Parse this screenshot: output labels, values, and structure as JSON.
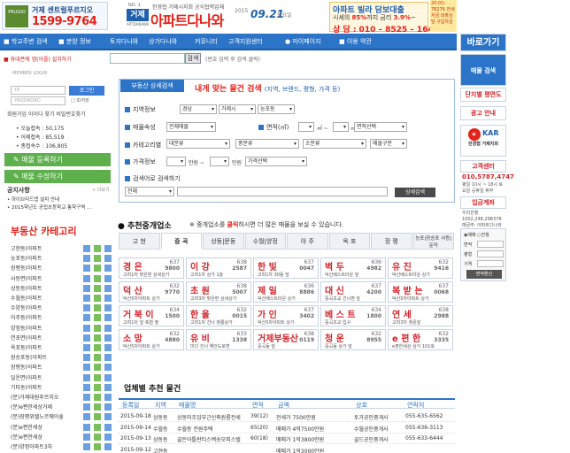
{
  "header": {
    "ad_left_logo": "PRUGIO",
    "ad_left_line1": "거제 센트럴푸르지오",
    "ad_left_phone": "1599-9764",
    "logo_no": "NO. 1",
    "logo_box": "거제",
    "logo_sub": "APTDANAWA",
    "logo_caption": "한경협 거제시지회 공식협력업체",
    "logo_main": "아파트다나와",
    "year": "2015",
    "date": "09.21",
    "weekday": "월요일",
    "ad_mid_line1": "아파트 빌라 담보대출",
    "ad_mid_line2_prefix": "시세의 ",
    "ad_mid_rate1": "85%",
    "ad_mid_line2_mid": "까지 금리 ",
    "ad_mid_rate2": "3.9%",
    "ad_mid_line2_suffix": "~",
    "ad_mid_line3": "상 담 : 010 – 8525 – 1644",
    "ad_right": "20-01-78276 전세자금 대출상담 구입자금"
  },
  "nav": {
    "items": [
      "학교주변 검색",
      "분양 정보",
      "토지다나와",
      "상가다나와",
      "커뮤니티",
      "고객지원센터",
      "마이페이지",
      "이용 약관"
    ]
  },
  "search_bar": {
    "notice": "휴대폰에 앱(어플) 설치하기",
    "button": "검색",
    "hint": "(번호 입력 후 검색 클릭)"
  },
  "login": {
    "label": "MEMBER LOGIN",
    "id_placeholder": "ID",
    "pw_placeholder": "PASSWORD",
    "login_button": "로그인",
    "save_id": "ID저장",
    "links": "회원가입 아이디 찾기 비밀번호찾기",
    "stats": [
      {
        "label": "오늘접속",
        "value": "50,175"
      },
      {
        "label": "어제접속",
        "value": "85,519"
      },
      {
        "label": "총접속수",
        "value": "106,805"
      }
    ]
  },
  "left_buttons": {
    "register": "매물 등록하기",
    "modify": "매물 수정하기"
  },
  "notice_board": {
    "title": "공지사항",
    "more": "+ 더보기",
    "items": [
      "• 하이브리드앱 설치 안내",
      "• 2015학년도 공립초등학교 통학구역 …"
    ]
  },
  "categories": {
    "title": "부동산 카테고리",
    "items": [
      "고현동(아파트",
      "능포동(아파트",
      "장평동(아파트",
      "사등면(아파트",
      "상동동(아파트",
      "수월동(아파트",
      "수양동(아파트",
      "아주동(아파트",
      "양정동(아파트",
      "연초면(아파트",
      "옥포동(아파트",
      "장승포동(아파트",
      "장평동(아파트",
      "일운면(아파트",
      "기타동(아파트",
      "(분)거제대원푸르지오",
      "(분)e편한세상거제",
      "(분)장평위렐노르웨이숲",
      "(분)e편한세상",
      "(분)e편한세상",
      "(분)양정아파트3차",
      "(분)거제KCC스위첸"
    ]
  },
  "panel": {
    "tab": "부동산 상세검색",
    "title": "내게 맞는 물건 검색",
    "title_sub": "(지역, 브랜드, 평형, 가격 등)",
    "rows": {
      "region": "지역정보",
      "type": "매물속성",
      "category": "카테고리별",
      "price": "가격정보",
      "keyword": "검색어로 검색하기"
    },
    "region_sel": [
      "경남",
      "거제시",
      "능포동"
    ],
    "type_sel": "전체매물",
    "area_label": "면적(㎡)",
    "area_unit1": "㎡ ~",
    "area_unit2": "㎡",
    "area_sel": "면적선택",
    "cat_sel": [
      "대분류",
      "중분류",
      "소분류",
      "매물구분"
    ],
    "price_unit1": "만원 ~",
    "price_unit2": "만원",
    "price_sel": "가격선택",
    "keyword_sel": "전체",
    "search_button": "상세검색"
  },
  "recommend": {
    "title": "추천중개업소",
    "note_prefix": "※ 중개업소를 ",
    "note_click": "클릭",
    "note_suffix": "하시면 더 많은 매물을 보실 수 있습니다.",
    "tabs": [
      "고 현",
      "중 곡",
      "상동|문동",
      "수월|양정",
      "아 주",
      "옥 포",
      "장 평",
      "능포|장승포 사등|둔덕"
    ],
    "cards": [
      {
        "name": "경 은",
        "code1": "637",
        "code2": "9800",
        "desc": "고려1차 맞은편 상세상가"
      },
      {
        "name": "이 강",
        "code1": "638",
        "code2": "2587",
        "desc": "고려1차 상가 1층"
      },
      {
        "name": "한 빛",
        "code1": "637",
        "code2": "0047",
        "desc": "고려1차 30동 앞"
      },
      {
        "name": "벽 두",
        "code1": "636",
        "code2": "4982",
        "desc": "덕산베스트타운 앞"
      },
      {
        "name": "유 진",
        "code1": "632",
        "code2": "9416",
        "desc": "덕산베스트타운 상가"
      },
      {
        "name": "덕 산",
        "code1": "632",
        "code2": "9770",
        "desc": "덕산5차아파트 상가"
      },
      {
        "name": "초 원",
        "code1": "638",
        "code2": "5007",
        "desc": "고려3차 맞은편 상세상가"
      },
      {
        "name": "제 일",
        "code1": "636",
        "code2": "8886",
        "desc": "덕산베스트타운 상가"
      },
      {
        "name": "대 신",
        "code1": "637",
        "code2": "4200",
        "desc": "중곡초교 건너편 앞"
      },
      {
        "name": "복 받 는",
        "code1": "637",
        "code2": "0068",
        "desc": "덕산5차아파트 상가"
      },
      {
        "name": "거 북 이",
        "code1": "634",
        "code2": "1500",
        "desc": "고려1차 앞 축협 옆"
      },
      {
        "name": "한 울",
        "code1": "632",
        "code2": "0015",
        "desc": "고려1차 건너 청룡상가"
      },
      {
        "name": "가 인",
        "code1": "637",
        "code2": "3402",
        "desc": "덕산5차아파트 상가"
      },
      {
        "name": "베 스 트",
        "code1": "634",
        "code2": "1800",
        "desc": "중곡초교 입구"
      },
      {
        "name": "연 세",
        "code1": "638",
        "code2": "2988",
        "desc": "고려3차 정문앞"
      },
      {
        "name": "소 망",
        "code1": "632",
        "code2": "4880",
        "desc": "덕산5차아파트 상가"
      },
      {
        "name": "유 비",
        "code1": "633",
        "code2": "1338",
        "desc": "미다 건너 해안도로변"
      },
      {
        "name": "거제부동산",
        "code1": "638",
        "code2": "0119",
        "desc": "중곡동 앞"
      },
      {
        "name": "청 운",
        "code1": "632",
        "code2": "8955",
        "desc": "중곡동 상가 앞"
      },
      {
        "name": "e 편 한",
        "code1": "632",
        "code2": "3335",
        "desc": "e편한세상 상가 101호"
      }
    ]
  },
  "listing": {
    "title": "업체별 추천 물건",
    "headers": [
      "등록일",
      "지역",
      "매물명",
      "면적",
      "금액",
      "상호",
      "연락처"
    ],
    "rows": [
      [
        "2015-09-18",
        "상동동",
        "상동미조입부근신축원룸전세",
        "39(12)",
        "전세가 7500만원",
        "토가공인중개사",
        "055-635-6562"
      ],
      [
        "2015-09-14",
        "수월동",
        "수월동 전원주택",
        "65(20)",
        "매매가 4억7500만원",
        "수월공인중개사",
        "055-636-3113"
      ],
      [
        "2015-09-13",
        "상동동",
        "골든아틀란티스백송모피스텔",
        "60(18)",
        "매매가 1억3800만원",
        "골드공인중개사",
        "055-633-6444"
      ],
      [
        "2015-09-12",
        "고현동",
        "",
        "",
        "매매가 1억3000만원",
        "",
        ""
      ]
    ]
  },
  "right_col": {
    "top": "바로가기",
    "items": [
      "매물 검색",
      "단지별 평면도",
      "광고 안내",
      "한경협 거제지회",
      "고객센터"
    ],
    "phone": "010,5787,4747",
    "hours": "평일 10시 ~ 18시 토요일 공휴일 휴무",
    "map_item": "입금계좌",
    "extra": "우리은행 1002,248,298378 예금주: 아파트다나와"
  },
  "right_panel": {
    "radio1": "매매",
    "radio2": "전월",
    "label1": "면적",
    "label2": "평형",
    "label3": "가격",
    "button": "면적환산"
  }
}
